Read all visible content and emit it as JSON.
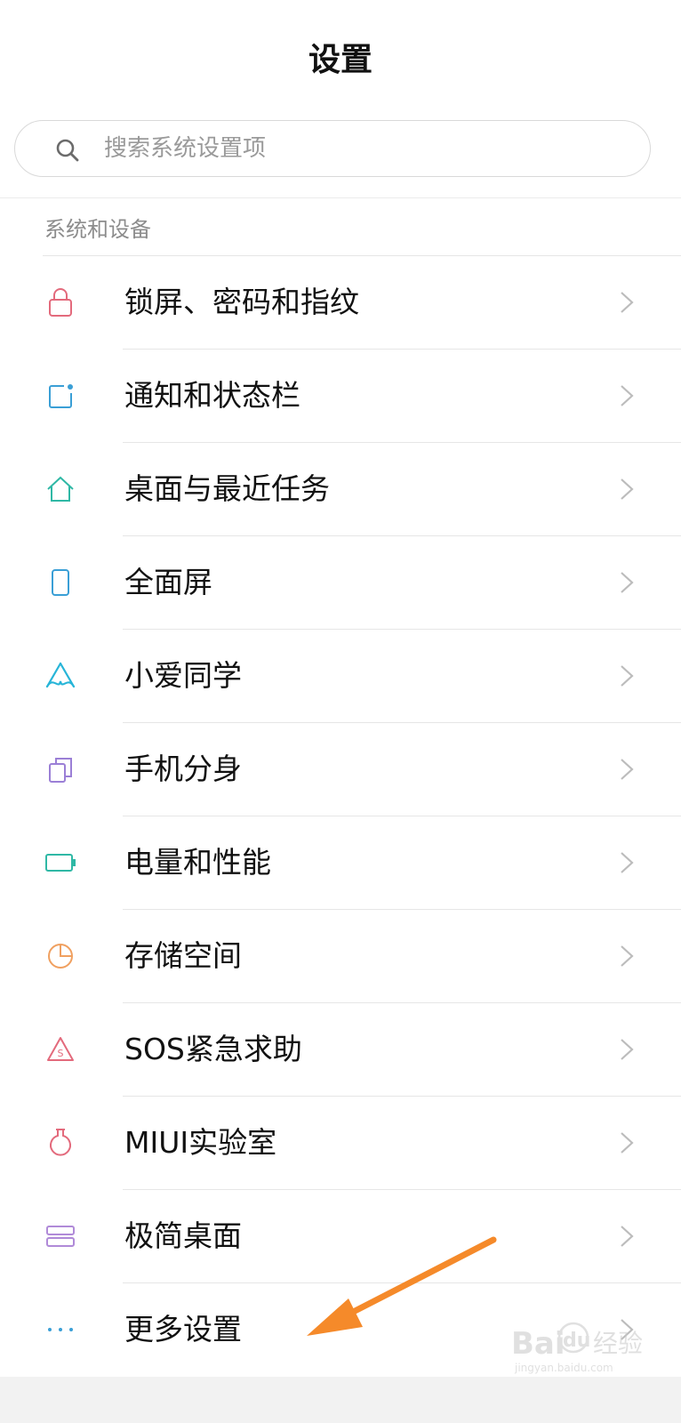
{
  "header": {
    "title": "设置"
  },
  "search": {
    "placeholder": "搜索系统设置项"
  },
  "section": {
    "title": "系统和设备"
  },
  "items": [
    {
      "label": "锁屏、密码和指纹",
      "icon": "lock-icon",
      "color": "#e36a7c"
    },
    {
      "label": "通知和状态栏",
      "icon": "notification-icon",
      "color": "#3a9fd6"
    },
    {
      "label": "桌面与最近任务",
      "icon": "home-icon",
      "color": "#2fb8a5"
    },
    {
      "label": "全面屏",
      "icon": "phone-icon",
      "color": "#3a9fd6"
    },
    {
      "label": "小爱同学",
      "icon": "xiaoai-icon",
      "color": "#27b5d8"
    },
    {
      "label": "手机分身",
      "icon": "dual-space-icon",
      "color": "#9b7fd6"
    },
    {
      "label": "电量和性能",
      "icon": "battery-icon",
      "color": "#2fb8a5"
    },
    {
      "label": "存储空间",
      "icon": "storage-pie-icon",
      "color": "#f0a060"
    },
    {
      "label": "SOS紧急求助",
      "icon": "sos-icon",
      "color": "#e36a7c"
    },
    {
      "label": "MIUI实验室",
      "icon": "lab-flask-icon",
      "color": "#e36a7c"
    },
    {
      "label": "极简桌面",
      "icon": "simple-desktop-icon",
      "color": "#b08ad8"
    },
    {
      "label": "更多设置",
      "icon": "more-dots-icon",
      "color": "#3a9fd6"
    }
  ],
  "annotation": {
    "arrow_color": "#f58a2a"
  },
  "watermark": {
    "brand": "Bai",
    "brand2": "du",
    "cn": "经验",
    "url": "jingyan.baidu.com"
  }
}
